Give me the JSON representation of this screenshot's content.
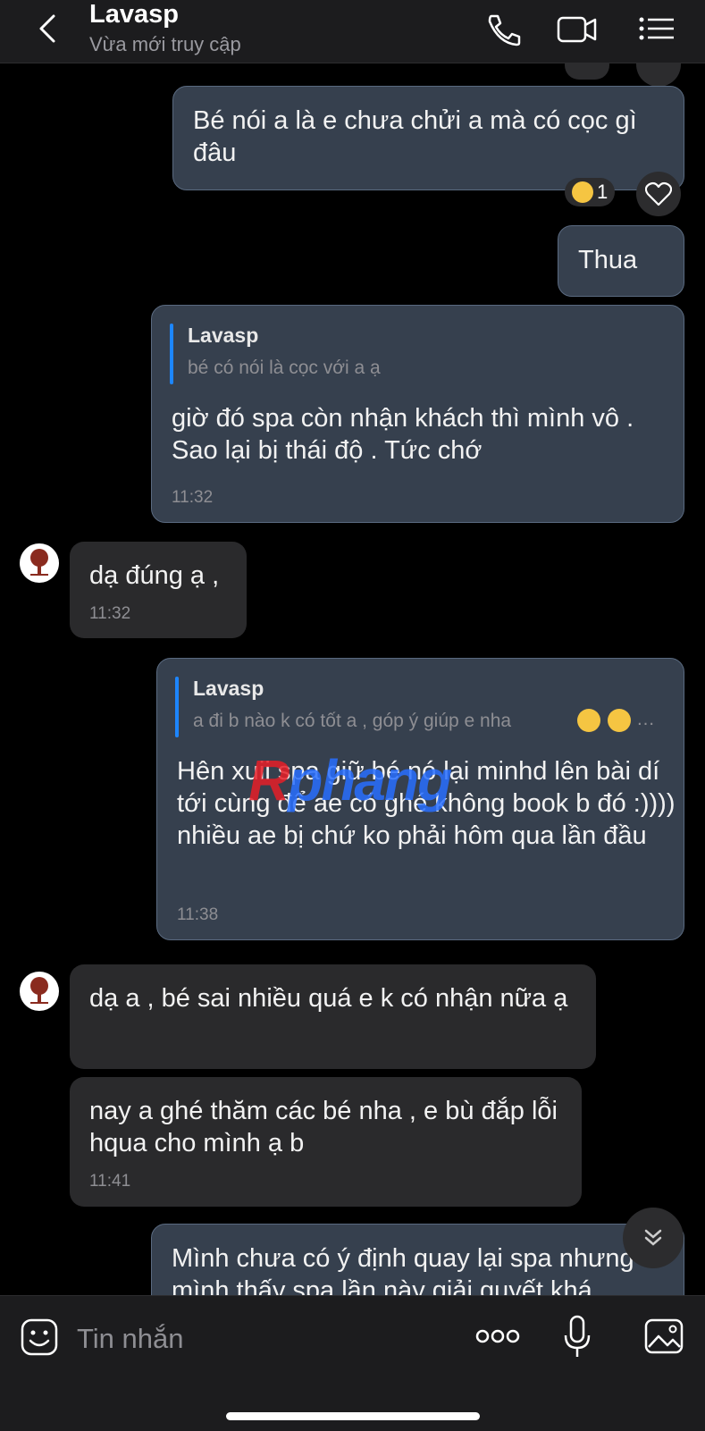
{
  "header": {
    "contact_name": "Lavasp",
    "status": "Vừa mới truy cập"
  },
  "messages": [
    {
      "text": "Bé nói a là e chưa chửi a mà có cọc gì đâu",
      "reaction_count": "1"
    },
    {
      "text": "Thua"
    },
    {
      "quote_name": "Lavasp",
      "quote_text": "bé có nói là  cọc với a ạ",
      "text": "giờ đó spa còn nhận khách thì mình vô . Sao lại bị thái độ . Tức chớ",
      "time": "11:32"
    },
    {
      "text": "dạ đúng ạ ,",
      "time": "11:32"
    },
    {
      "quote_name": "Lavasp",
      "quote_text": "a đi b nào k có tốt a , góp ý giúp e nha",
      "text": "Hên xuii spa giữ bé nó lại minhd lên bài dí tới cùng để ae có ghé không book b đó :)))) nhiều ae bị chứ ko phải hôm qua lần đầu",
      "time": "11:38"
    },
    {
      "text": "dạ a , bé sai nhiều quá e k có nhận nữa ạ"
    },
    {
      "text": "nay a ghé thăm các bé nha , e bù đắp lỗi hqua cho mình ạ b",
      "time": "11:41"
    },
    {
      "text": "Mình chưa có ý định quay lại spa nhưng mình thấy spa lần này giải quyết khá"
    }
  ],
  "watermark": {
    "part1": "R",
    "part2": "phang"
  },
  "input": {
    "placeholder": "Tin nhắn"
  }
}
